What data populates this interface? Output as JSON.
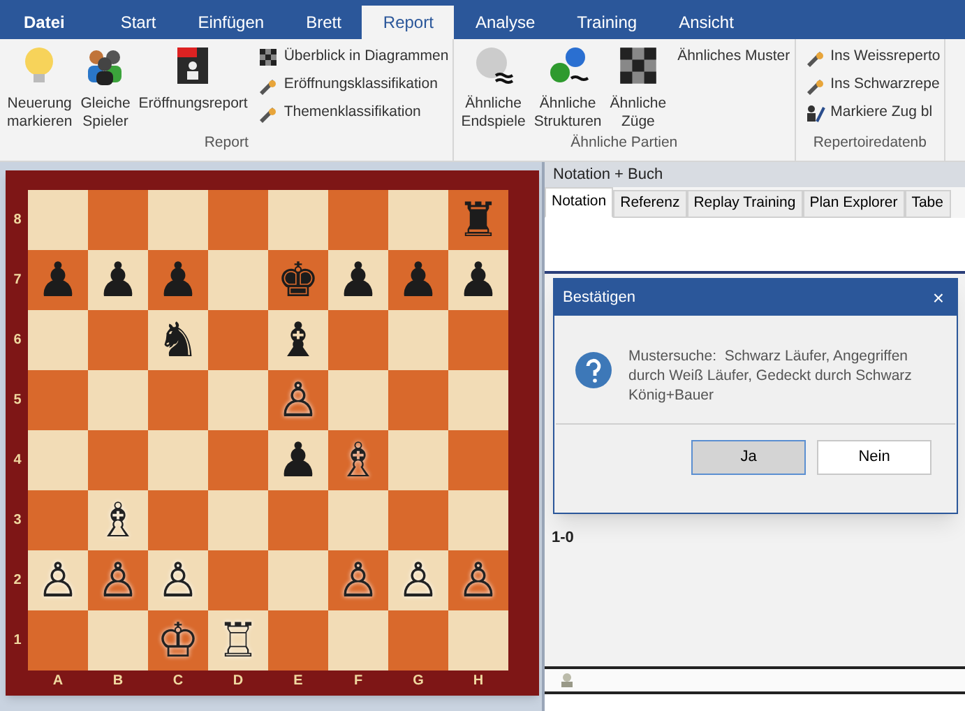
{
  "menu_tabs": [
    {
      "label": "Datei",
      "selected": false,
      "kind": "file"
    },
    {
      "label": "Start",
      "selected": false
    },
    {
      "label": "Einfügen",
      "selected": false
    },
    {
      "label": "Brett",
      "selected": false
    },
    {
      "label": "Report",
      "selected": true
    },
    {
      "label": "Analyse",
      "selected": false
    },
    {
      "label": "Training",
      "selected": false
    },
    {
      "label": "Ansicht",
      "selected": false
    }
  ],
  "ribbon_groups": [
    {
      "label": "Report",
      "large": [
        {
          "label": "Neuerung\nmarkieren"
        },
        {
          "label": "Gleiche\nSpieler"
        },
        {
          "label": "Eröffnungsreport"
        }
      ],
      "small": [
        {
          "label": "Überblick in Diagrammen"
        },
        {
          "label": "Eröffnungsklassifikation"
        },
        {
          "label": "Themenklassifikation"
        }
      ]
    },
    {
      "label": "Ähnliche Partien",
      "large": [
        {
          "label": "Ähnliche\nEndspiele"
        },
        {
          "label": "Ähnliche\nStrukturen"
        },
        {
          "label": "Ähnliche\nZüge"
        }
      ],
      "small": [
        {
          "label": "Ähnliches Muster"
        }
      ]
    },
    {
      "label": "Repertoiredatenb",
      "small": [
        {
          "label": "Ins Weissreperto"
        },
        {
          "label": "Ins Schwarzrepe"
        },
        {
          "label": "Markiere Zug bl"
        }
      ]
    }
  ],
  "board": {
    "files": [
      "A",
      "B",
      "C",
      "D",
      "E",
      "F",
      "G",
      "H"
    ],
    "ranks": [
      {
        "label": "8",
        "cells": [
          {},
          {},
          {},
          {},
          {},
          {},
          {},
          {
            "piece": "♜",
            "kind": "black"
          }
        ]
      },
      {
        "label": "7",
        "cells": [
          {
            "piece": "♟",
            "kind": "black"
          },
          {
            "piece": "♟",
            "kind": "black"
          },
          {
            "piece": "♟",
            "kind": "black"
          },
          {},
          {
            "piece": "♚",
            "kind": "black"
          },
          {
            "piece": "♟",
            "kind": "black"
          },
          {
            "piece": "♟",
            "kind": "black"
          },
          {
            "piece": "♟",
            "kind": "black"
          }
        ]
      },
      {
        "label": "6",
        "cells": [
          {},
          {},
          {
            "piece": "♞",
            "kind": "black"
          },
          {},
          {
            "piece": "♝",
            "kind": "black"
          },
          {},
          {},
          {}
        ]
      },
      {
        "label": "5",
        "cells": [
          {},
          {},
          {},
          {},
          {
            "piece": "♙",
            "kind": "white"
          },
          {},
          {},
          {}
        ]
      },
      {
        "label": "4",
        "cells": [
          {},
          {},
          {},
          {},
          {
            "piece": "♟",
            "kind": "black"
          },
          {
            "piece": "♗",
            "kind": "white"
          },
          {},
          {}
        ]
      },
      {
        "label": "3",
        "cells": [
          {},
          {
            "piece": "♗",
            "kind": "white"
          },
          {},
          {},
          {},
          {},
          {},
          {}
        ]
      },
      {
        "label": "2",
        "cells": [
          {
            "piece": "♙",
            "kind": "white"
          },
          {
            "piece": "♙",
            "kind": "white"
          },
          {
            "piece": "♙",
            "kind": "white"
          },
          {},
          {},
          {
            "piece": "♙",
            "kind": "white"
          },
          {
            "piece": "♙",
            "kind": "white"
          },
          {
            "piece": "♙",
            "kind": "white"
          }
        ]
      },
      {
        "label": "1",
        "cells": [
          {},
          {},
          {
            "piece": "♔",
            "kind": "white"
          },
          {
            "piece": "♖",
            "kind": "white"
          },
          {},
          {},
          {},
          {}
        ]
      }
    ]
  },
  "notation_panel": {
    "title": "Notation + Buch",
    "tabs": [
      {
        "label": "Notation",
        "selected": true
      },
      {
        "label": "Referenz",
        "selected": false
      },
      {
        "label": "Replay Training",
        "selected": false
      },
      {
        "label": "Plan Explorer",
        "selected": false
      },
      {
        "label": "Tabe",
        "selected": false
      }
    ],
    "result": "1-0"
  },
  "dialog": {
    "title": "Bestätigen",
    "close": "×",
    "message": "Mustersuche:  Schwarz Läufer, Angegriffen durch Weiß Läufer, Gedeckt durch Schwarz König+Bauer",
    "buttons": [
      {
        "label": "Ja",
        "selected": true
      },
      {
        "label": "Nein",
        "selected": false
      }
    ]
  }
}
